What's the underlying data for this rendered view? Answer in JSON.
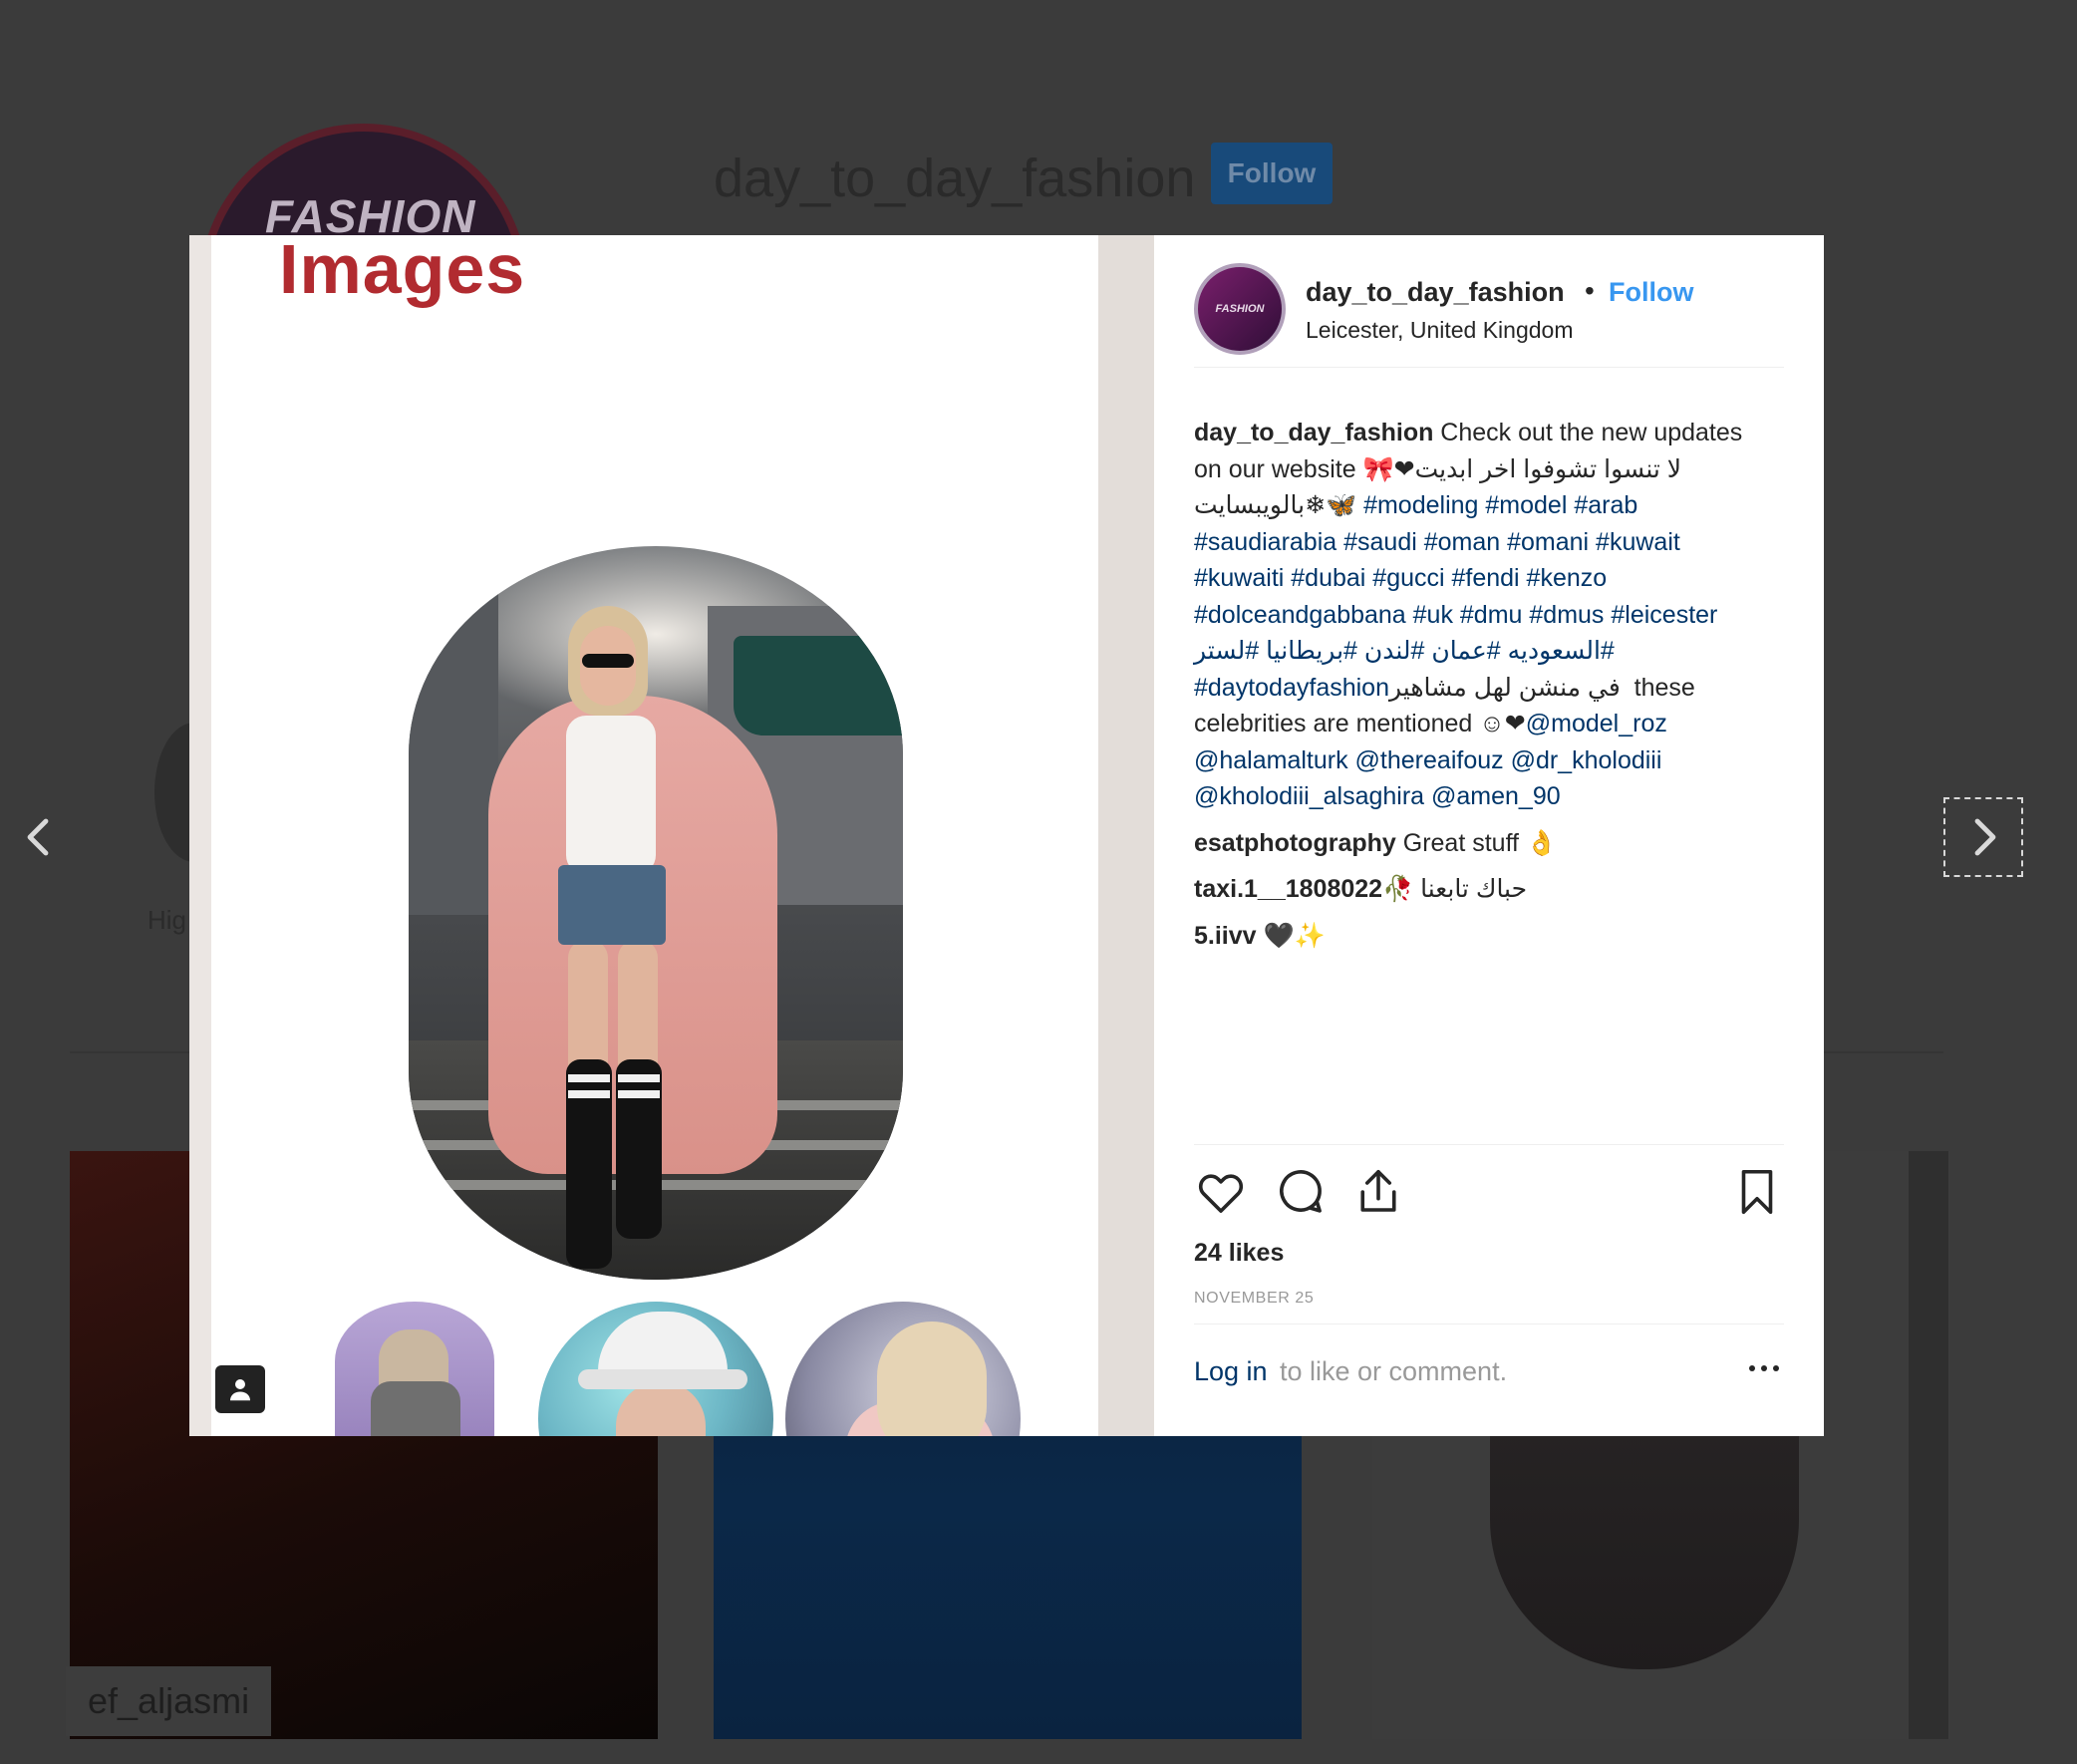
{
  "background": {
    "username": "day_to_day_fashion",
    "follow_label": "Follow",
    "avatar_text": "FASHION",
    "highlight_label": "Hig",
    "grid_handle": "ef_aljasmi"
  },
  "modal": {
    "media_title": "Images",
    "header": {
      "username": "day_to_day_fashion",
      "separator": "•",
      "follow_label": "Follow",
      "location": "Leicester, United Kingdom"
    },
    "caption": {
      "username": "day_to_day_fashion",
      "text_1": " Check out the new updates on our website ",
      "emoji_1": "🎀❤",
      "arabic_1": " لا تنسوا تشوفوا اخر ابديت بالويبسايت",
      "emoji_2": "❄🦋",
      "hashtags_1": " #modeling #model #arab #saudiarabia #saudi #oman #omani #kuwait #kuwaiti #dubai #gucci #fendi #kenzo #dolceandgabbana #uk #dmu #dmus #leicester",
      "hashtags_ar": " #السعوديه #عمان #لندن #بريطانيا #لستر",
      "hashtags_2": " #daytodayfashion",
      "arabic_2": " في منشن لهل مشاهير",
      "text_2": " these celebrities are mentioned ",
      "emoji_3": "☺❤",
      "mentions": "@model_roz @halamalturk @thereaifouz @dr_kholodiii @kholodiii_alsaghira @amen_90"
    },
    "comments": [
      {
        "username": "esatphotography",
        "text": " Great stuff 👌"
      },
      {
        "username": "taxi.1__1808022",
        "text": " حباك تابعنا 🥀"
      },
      {
        "username": "5.iivv",
        "text": " 🖤✨"
      }
    ],
    "likes": "24 likes",
    "date": "NOVEMBER 25",
    "login_link": "Log in",
    "login_rest": " to like or comment.",
    "icons": {
      "like": "heart-icon",
      "comment": "comment-icon",
      "share": "share-icon",
      "save": "bookmark-icon",
      "more": "more-icon",
      "camera": "camera-icon",
      "prev": "chevron-left-icon",
      "next": "chevron-right-icon"
    }
  }
}
